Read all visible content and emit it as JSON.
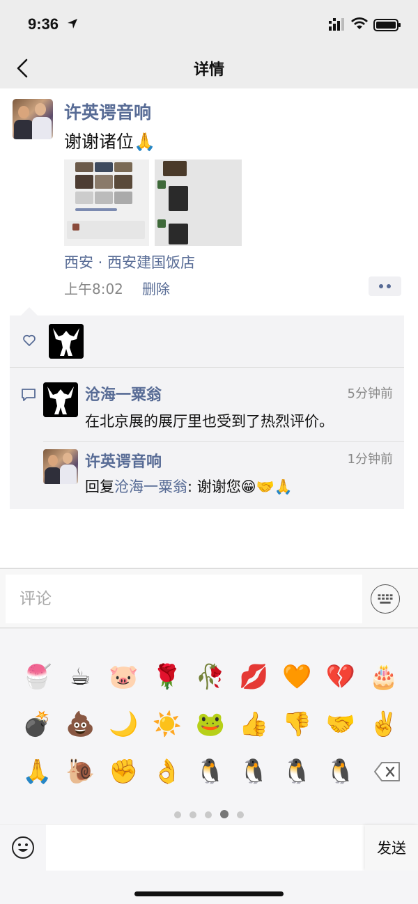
{
  "status_bar": {
    "time": "9:36"
  },
  "nav": {
    "title": "详情"
  },
  "post": {
    "author": "许英谔音响",
    "text": "谢谢诸位🙏",
    "location": "西安 · 西安建国饭店",
    "time": "上午8:02",
    "delete_label": "删除"
  },
  "comments": [
    {
      "author": "沧海一粟翁",
      "time": "5分钟前",
      "text": "在北京展的展厅里也受到了热烈评价。"
    },
    {
      "author": "许英谔音响",
      "time": "1分钟前",
      "reply_prefix": "回复",
      "reply_to": "沧海一粟翁",
      "text": ": 谢谢您😁🤝🙏"
    }
  ],
  "comment_input": {
    "placeholder": "评论"
  },
  "emoji_rows": [
    [
      "🍧",
      "☕",
      "🐷",
      "🌹",
      "🥀",
      "💋",
      "🧡",
      "💔",
      "🎂"
    ],
    [
      "💣",
      "💩",
      "🌙",
      "☀️",
      "🐸",
      "👍",
      "👎",
      "🤝",
      "✌️"
    ],
    [
      "🙏",
      "🐌",
      "✊",
      "👌",
      "🐧",
      "🐧",
      "🐧",
      "🐧"
    ]
  ],
  "page_dots": {
    "count": 5,
    "active_index": 3
  },
  "send_button": "发送"
}
